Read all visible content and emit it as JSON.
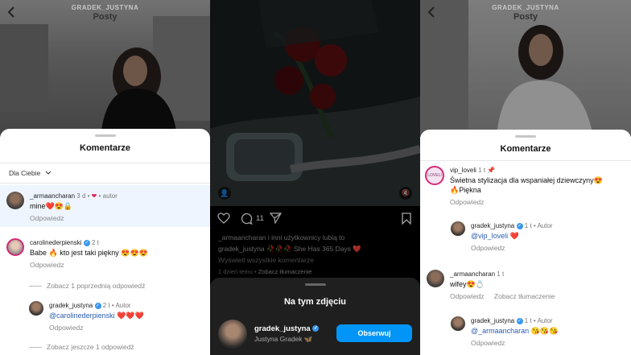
{
  "left": {
    "username": "GRADEK_JUSTYNA",
    "title": "Posty",
    "sheet_title": "Komentarze",
    "sort": "Dla Ciebie",
    "comments": [
      {
        "user": "_armaancharan",
        "time": "3 d",
        "extra": "• autor",
        "text": "mine❤️😍🔒",
        "reply": "Odpowiedz"
      },
      {
        "user": "carolinederpienski",
        "time": "2 t",
        "text": "Babe 🔥 kto jest taki piękny 😍😍😍",
        "reply": "Odpowiedz"
      },
      {
        "user": "gradek_justyna",
        "time": "2 t",
        "extra": "• Autor",
        "mention": "@carolinederpienski",
        "text": "❤️❤️❤️",
        "reply": "Odpowiedz"
      }
    ],
    "thread1": "Zobacz 1 poprzednią odpowiedź",
    "thread2": "Zobacz jeszcze 1 odpowiedź"
  },
  "middle": {
    "likes_count": "11",
    "caption_line1": "_armaancharan i inni użytkownicy lubią to",
    "caption_line2": "gradek_justyna 🥀🥀🥀 She Has 365 Days ❤️",
    "view_all": "Wyświetl wszystkie komentarze",
    "time": "1 dzień temu",
    "translate": "Zobacz tłumaczenie",
    "sheet_title": "Na tym zdjęciu",
    "person_user": "gradek_justyna",
    "person_name": "Justyna Gradek 🦋",
    "follow": "Obserwuj"
  },
  "right": {
    "username": "GRADEK_JUSTYNA",
    "title": "Posty",
    "sheet_title": "Komentarze",
    "comments": [
      {
        "user": "vip_loveli",
        "time": "1 t",
        "text": "Świetna stylizacja dla wspaniałej dziewczyny😍",
        "text2": "🔥Piękna",
        "reply": "Odpowiedz"
      },
      {
        "user": "gradek_justyna",
        "time": "1 t",
        "extra": "• Autor",
        "mention": "@vip_loveli",
        "text": "❤️",
        "reply": "Odpowiedz"
      },
      {
        "user": "_armaancharan",
        "time": "1 t",
        "text": "wifey😍💍",
        "reply": "Odpowiedz",
        "translate": "Zobacz tłumaczenie"
      },
      {
        "user": "gradek_justyna",
        "time": "1 t",
        "extra": "• Autor",
        "mention": "@_armaancharan",
        "text": "😘😘😘",
        "reply": "Odpowiedz"
      }
    ],
    "avatar_badge": "LOVELI"
  }
}
